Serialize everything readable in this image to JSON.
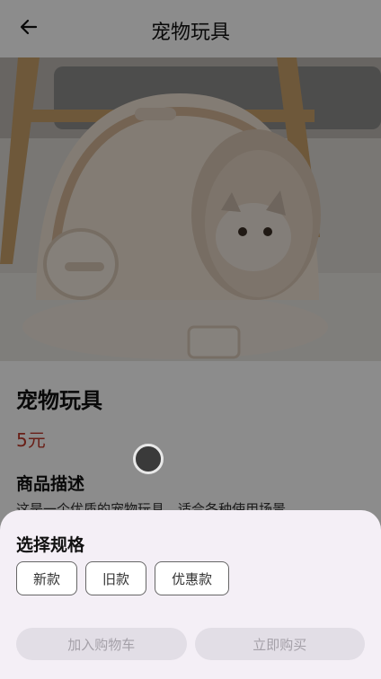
{
  "appbar": {
    "title": "宠物玩具",
    "back_icon": "arrow-left-icon"
  },
  "product": {
    "name": "宠物玩具",
    "price": "5元",
    "description_title": "商品描述",
    "description": "这是一个优质的宠物玩具，适合各种使用场景。"
  },
  "sheet": {
    "title": "选择规格",
    "specs": [
      "新款",
      "旧款",
      "优惠款"
    ],
    "add_to_cart": "加入购物车",
    "buy_now": "立即购买"
  },
  "colors": {
    "price": "#c0392b",
    "sheet_bg": "#f4eff6",
    "disabled_text": "#a4a0a8"
  }
}
